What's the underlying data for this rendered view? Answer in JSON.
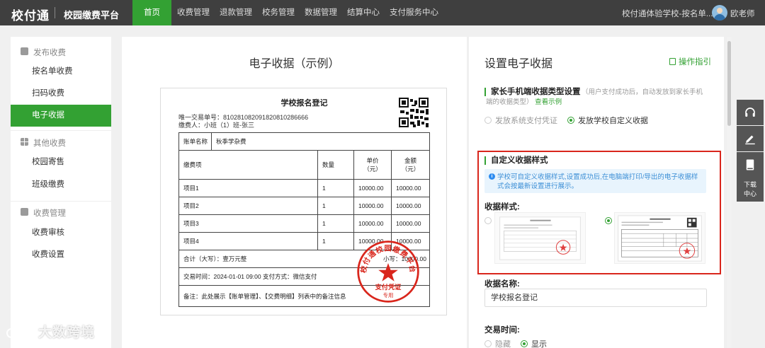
{
  "topbar": {
    "logo": "校付通",
    "platform": "校园缴费平台",
    "nav": [
      "首页",
      "收费管理",
      "退款管理",
      "校务管理",
      "数据管理",
      "结算中心",
      "支付服务中心"
    ],
    "school": "校付通体验学校-按名单...",
    "user": "欧老师"
  },
  "sidebar": {
    "groups": [
      {
        "label": "发布收费",
        "icon": "edit-icon",
        "items": [
          "按名单收费",
          "扫码收费",
          "电子收据"
        ]
      },
      {
        "label": "其他收费",
        "icon": "grid-icon",
        "items": [
          "校园寄售",
          "班级缴费"
        ]
      },
      {
        "label": "收费管理",
        "icon": "download-box-icon",
        "items": [
          "收费审核",
          "收费设置"
        ]
      }
    ],
    "active": "电子收据"
  },
  "preview": {
    "title": "电子收据（示例）",
    "receipt": {
      "title": "学校报名登记",
      "transaction_line": "唯一交易单号：810281082091820810286666",
      "payer_line": "缴费人：小班（1）班-张三",
      "bill_label": "账单名称",
      "bill_value": "秋季学杂费",
      "headers": [
        "缴费项",
        "数量",
        "单价\n（元）",
        "金额\n（元）"
      ],
      "rows": [
        [
          "项目1",
          "1",
          "10000.00",
          "10000.00"
        ],
        [
          "项目2",
          "1",
          "10000.00",
          "10000.00"
        ],
        [
          "项目3",
          "1",
          "10000.00",
          "10000.00"
        ],
        [
          "项目4",
          "1",
          "10000.00",
          "10000.00"
        ]
      ],
      "total_caps": "合计（大写）：壹万元整",
      "subtotal": "小写：10000.00",
      "trade_info": "交易时间：2024-01-01 09:00    支付方式：微信支付",
      "remark": "备注：此处展示【账单管理】、【交费明细】列表中的备注信息",
      "stamp_top": "校付通校园缴费平台",
      "stamp_bottom": "支付凭证",
      "stamp_foot": "专用"
    }
  },
  "settings": {
    "title": "设置电子收据",
    "guide": "操作指引",
    "type_section": {
      "title": "家长手机端收据类型设置",
      "note": "（用户支付成功后，自动发放到家长手机端的收据类型）",
      "link": "查看示例",
      "options": [
        "发放系统支付凭证",
        "发放学校自定义收据"
      ],
      "selected": 1
    },
    "custom_section": {
      "title": "自定义收据样式",
      "info": "学校可自定义收据样式,设置成功后,在电脑端打印/导出的电子收据样式会按最新设置进行展示。",
      "style_label": "收据样式:",
      "selected_style": 1
    },
    "name_label": "收据名称:",
    "name_value": "学校报名登记",
    "time_label": "交易时间:",
    "time_options": [
      "隐藏",
      "显示"
    ],
    "time_selected": 1
  },
  "float_tools": {
    "items": [
      "headset-icon",
      "pen-icon",
      "book-icon"
    ],
    "download_label": "下载\n中心"
  },
  "watermark": "大数跨境",
  "colors": {
    "brand_green": "#33a133",
    "topbar": "#3f3f3f",
    "highlight_red": "#d9261c",
    "stamp_red": "#d9261c",
    "info_blue": "#3d8fd6"
  }
}
